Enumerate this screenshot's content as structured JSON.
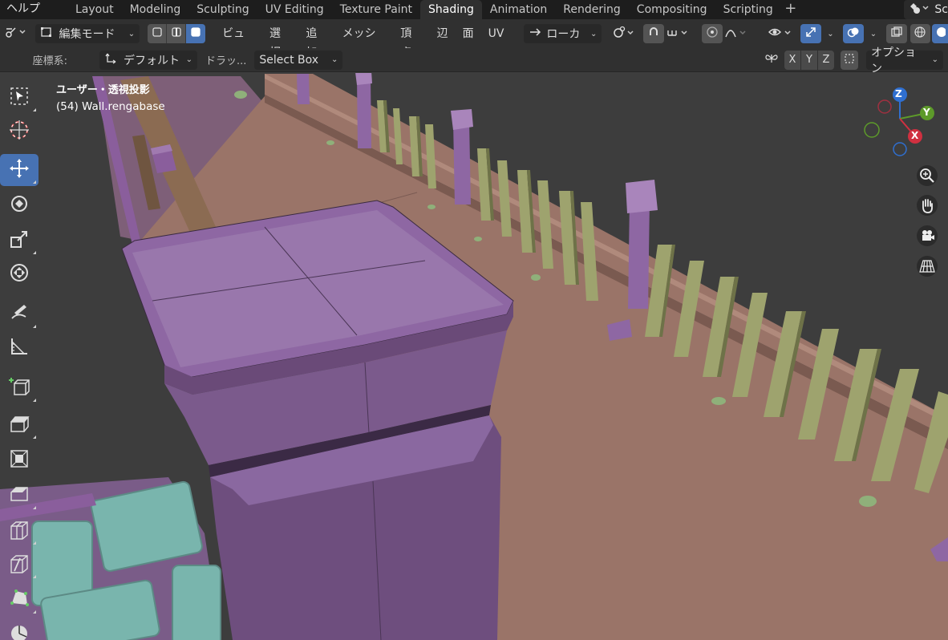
{
  "topbar": {
    "help_menu": "ヘルプ",
    "tabs": [
      "Layout",
      "Modeling",
      "Sculpting",
      "UV Editing",
      "Texture Paint",
      "Shading",
      "Animation",
      "Rendering",
      "Compositing",
      "Scripting"
    ],
    "active_tab": "Shading",
    "add_tab": "+",
    "scene_label": "Sc"
  },
  "header": {
    "mode": "編集モード",
    "menus": [
      "ビュー",
      "選択",
      "追加",
      "メッシュ",
      "頂点",
      "辺",
      "面",
      "UV"
    ],
    "transform_orientation": "ローカ",
    "coord_label": "座標系:",
    "coord_value": "デフォルト",
    "drag_label": "ドラッ...",
    "select_box": "Select Box",
    "axis_x": "X",
    "axis_y": "Y",
    "axis_z": "Z",
    "options": "オプション"
  },
  "viewport": {
    "view_name": "ユーザー・透視投影",
    "object_info": "(54) Wall.rengabase"
  },
  "gizmo": {
    "z": "Z",
    "y": "Y",
    "x": "X"
  },
  "colors": {
    "accent": "#4772b3",
    "floor": "#9a7468",
    "post": "#8e67a3",
    "baluster": "#9ea36e",
    "tile": "#79b5ad"
  }
}
